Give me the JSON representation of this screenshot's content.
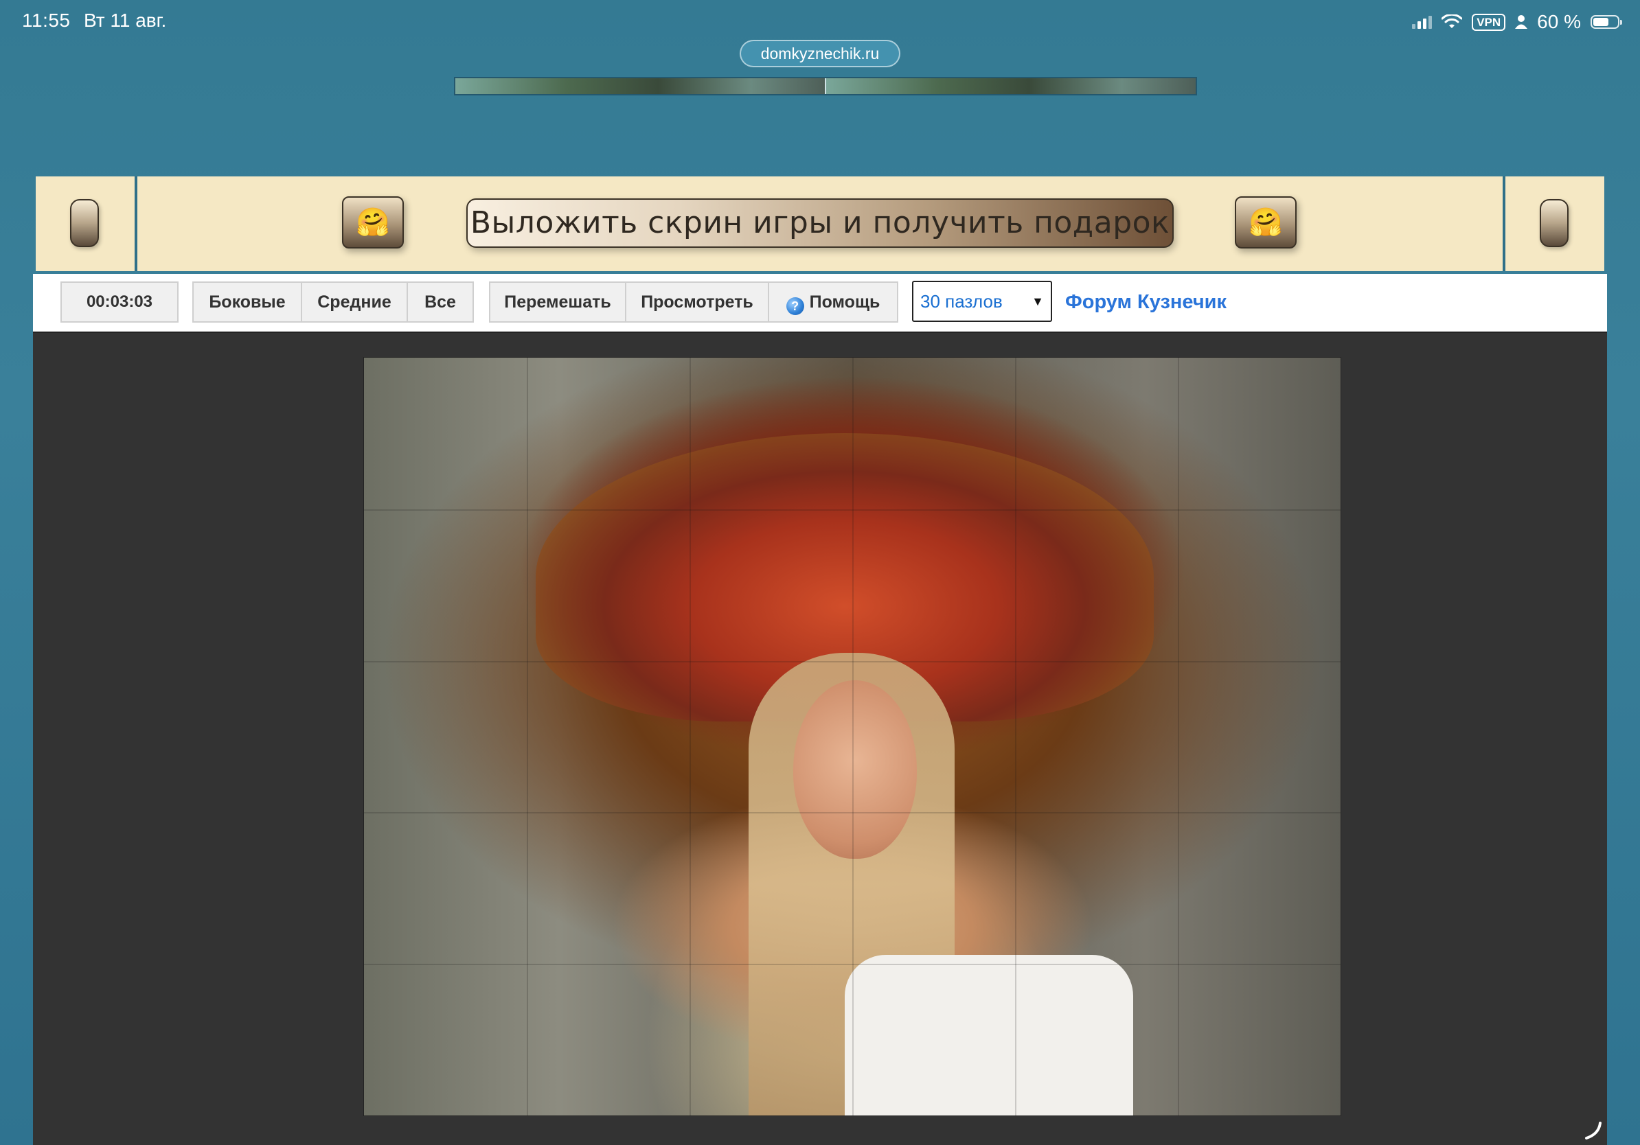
{
  "status_bar": {
    "time": "11:55",
    "date": "Вт 11 авг.",
    "vpn_label": "VPN",
    "battery_text": "60 %",
    "battery_level": 0.6
  },
  "browser": {
    "url": "domkyznechik.ru"
  },
  "banner": {
    "main_label": "Выложить скрин игры и получить подарок",
    "left_emoji": "🤗",
    "right_emoji": "🤗"
  },
  "toolbar": {
    "timer": "00:03:03",
    "filter_buttons": [
      "Боковые",
      "Средние",
      "Все"
    ],
    "shuffle_label": "Перемешать",
    "preview_label": "Просмотреть",
    "help_label": "Помощь",
    "pieces_select_value": "30 пазлов",
    "forum_link": "Форум Кузнечик"
  },
  "puzzle": {
    "columns": 6,
    "rows": 5,
    "piece_count": 30
  },
  "colors": {
    "page_bg": "#3a7d97",
    "banner_bg": "#f5e8c4",
    "game_area_bg": "#333333",
    "link_color": "#2a74d9"
  },
  "icons": {
    "help": "question-circle-icon",
    "wifi": "wifi-icon",
    "signal": "cellular-signal-icon",
    "battery": "battery-icon",
    "person": "person-icon",
    "dropdown": "caret-down-icon",
    "loading": "loading-swoosh-icon"
  }
}
